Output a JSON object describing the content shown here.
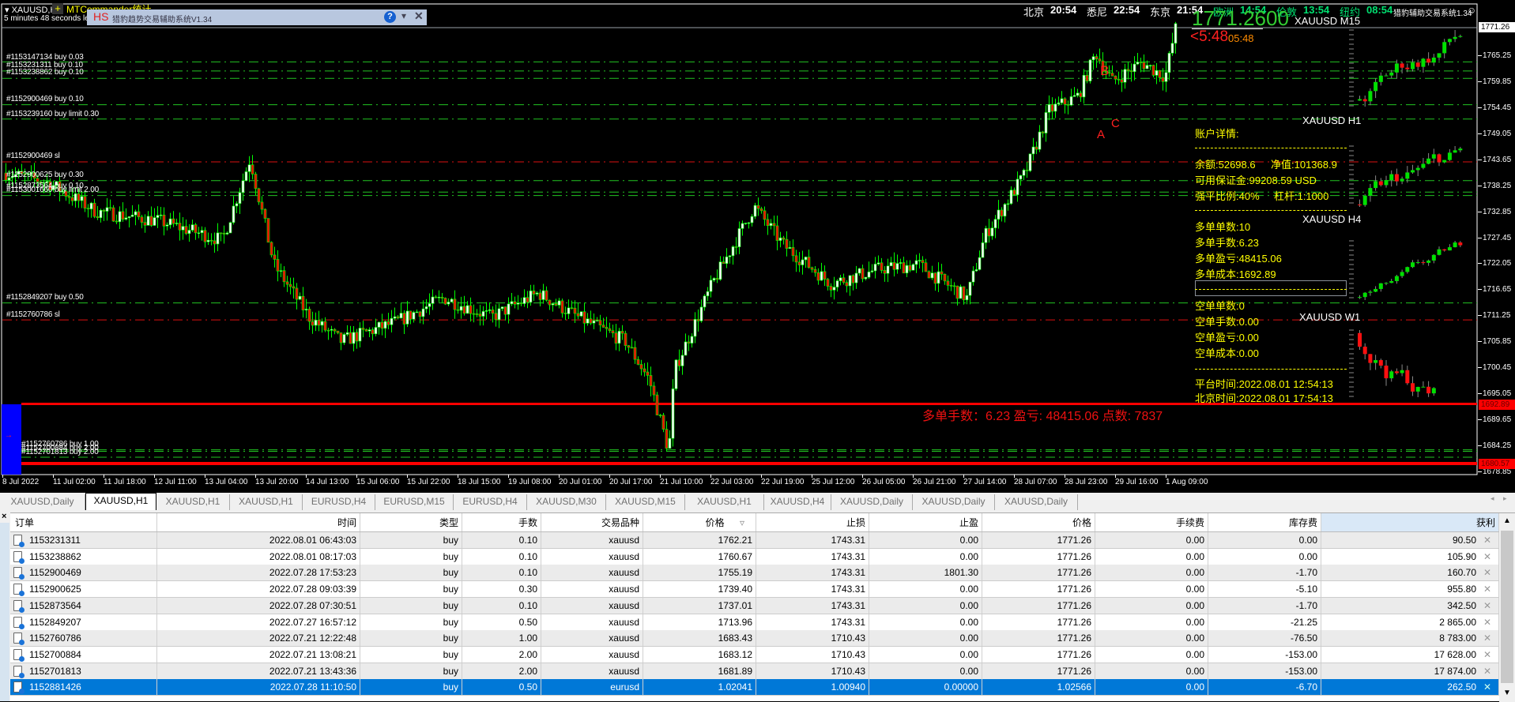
{
  "window": {
    "symbol_title": "XAUUSD,H1",
    "plugin_label": "MTCommander统计",
    "bar_timer": "5 minutes 48 seconds left to bar end"
  },
  "dialog": {
    "logo": "HS",
    "title": "猎豹趋势交易辅助系统V1.34",
    "help_icon": "question-icon",
    "menu_icon": "chevron-down-icon",
    "close_icon": "close-icon"
  },
  "clocks": [
    {
      "city": "北京",
      "time": "20:54",
      "group": "asia"
    },
    {
      "city": "悉尼",
      "time": "22:54",
      "group": "asia"
    },
    {
      "city": "东京",
      "time": "21:54",
      "group": "asia"
    },
    {
      "city": "欧洲",
      "time": "14:54",
      "group": "west"
    },
    {
      "city": "伦敦",
      "time": "13:54",
      "group": "west"
    },
    {
      "city": "纽约",
      "time": "08:54",
      "group": "west"
    }
  ],
  "system_label": "猎豹辅助交易系统1.34",
  "current_price": "1771.2600",
  "countdown": "<5:48",
  "countdown2": "05:48",
  "mini_charts": [
    "XAUUSD M15",
    "XAUUSD H1",
    "XAUUSD H4",
    "XAUUSD W1"
  ],
  "account": {
    "title": "账户详情:",
    "balance": "余额:52698.6",
    "equity": "净值:101368.9",
    "free_margin": "可用保证金:99208.59 USD",
    "stopout": "强平比例:40%",
    "leverage": "杠杆:1:1000",
    "long_count": "多单单数:10",
    "long_lots": "多单手数:6.23",
    "long_pl": "多单盈亏:48415.06",
    "long_cost": "多单成本:1692.89",
    "short_count": "空单单数:0",
    "short_lots": "空单手数:0.00",
    "short_pl": "空单盈亏:0.00",
    "short_cost": "空单成本:0.00",
    "platform_time": "平台时间:2022.08.01 12:54:13",
    "beijing_time": "北京时间:2022.08.01 17:54:13"
  },
  "summary_line": "多单手数：6.23  盈亏: 48415.06  点数: 7837",
  "pattern_labels": [
    "A",
    "B",
    "C"
  ],
  "order_labels": [
    "#1153147134 buy 0.03",
    "#1153231311 buy 0.10",
    "#1153238862 buy 0.10",
    "#1152900469 buy 0.10",
    "#1153239160 buy limit 0.30",
    "#1152900469 sl",
    "#1152900625 buy 0.30",
    "#1152873564 buy 0.10",
    "#1153001660 buy limit 2.00",
    "#1152849207 buy 0.50",
    "#1152760786 sl",
    "#1152760786 buy 1.00",
    "#1152700884 buy 2.00",
    "#1152701813 buy 2.00"
  ],
  "price_axis": [
    "1765.25",
    "1759.85",
    "1754.45",
    "1749.05",
    "1743.65",
    "1738.25",
    "1732.85",
    "1727.45",
    "1722.05",
    "1716.65",
    "1711.25",
    "1705.85",
    "1700.45",
    "1695.05",
    "1689.65",
    "1684.25",
    "1678.85"
  ],
  "price_tags": {
    "bid": "1771.26",
    "cost": "1692.89",
    "low": "1680.57"
  },
  "time_axis": [
    "8 Jul 2022",
    "11 Jul 02:00",
    "11 Jul 18:00",
    "12 Jul 11:00",
    "13 Jul 04:00",
    "13 Jul 20:00",
    "14 Jul 13:00",
    "15 Jul 06:00",
    "15 Jul 22:00",
    "18 Jul 15:00",
    "19 Jul 08:00",
    "20 Jul 01:00",
    "20 Jul 17:00",
    "21 Jul 10:00",
    "22 Jul 03:00",
    "22 Jul 19:00",
    "25 Jul 12:00",
    "26 Jul 05:00",
    "26 Jul 21:00",
    "27 Jul 14:00",
    "28 Jul 07:00",
    "28 Jul 23:00",
    "29 Jul 16:00",
    "1 Aug 09:00"
  ],
  "tabs": [
    {
      "label": "XAUUSD,Daily",
      "active": false
    },
    {
      "label": "XAUUSD,H1",
      "active": true
    },
    {
      "label": "XAUUSD,H1",
      "active": false
    },
    {
      "label": "XAUUSD,H1",
      "active": false
    },
    {
      "label": "EURUSD,H4",
      "active": false
    },
    {
      "label": "EURUSD,M15",
      "active": false
    },
    {
      "label": "EURUSD,H4",
      "active": false
    },
    {
      "label": "XAUUSD,M30",
      "active": false
    },
    {
      "label": "XAUUSD,M15",
      "active": false
    },
    {
      "label": "XAUUSD,H1",
      "active": false
    },
    {
      "label": "XAUUSD,H4",
      "active": false
    },
    {
      "label": "XAUUSD,Daily",
      "active": false
    },
    {
      "label": "XAUUSD,Daily",
      "active": false
    },
    {
      "label": "XAUUSD,Daily",
      "active": false
    }
  ],
  "table": {
    "columns": [
      "订单",
      "时间",
      "类型",
      "手数",
      "交易品种",
      "价格",
      "止损",
      "止盈",
      "价格",
      "手续费",
      "库存费",
      "获利"
    ],
    "sorted_column": "价格",
    "rows": [
      [
        "1153231311",
        "2022.08.01 06:43:03",
        "buy",
        "0.10",
        "xauusd",
        "1762.21",
        "1743.31",
        "0.00",
        "1771.26",
        "0.00",
        "0.00",
        "90.50"
      ],
      [
        "1153238862",
        "2022.08.01 08:17:03",
        "buy",
        "0.10",
        "xauusd",
        "1760.67",
        "1743.31",
        "0.00",
        "1771.26",
        "0.00",
        "0.00",
        "105.90"
      ],
      [
        "1152900469",
        "2022.07.28 17:53:23",
        "buy",
        "0.10",
        "xauusd",
        "1755.19",
        "1743.31",
        "1801.30",
        "1771.26",
        "0.00",
        "-1.70",
        "160.70"
      ],
      [
        "1152900625",
        "2022.07.28 09:03:39",
        "buy",
        "0.30",
        "xauusd",
        "1739.40",
        "1743.31",
        "0.00",
        "1771.26",
        "0.00",
        "-5.10",
        "955.80"
      ],
      [
        "1152873564",
        "2022.07.28 07:30:51",
        "buy",
        "0.10",
        "xauusd",
        "1737.01",
        "1743.31",
        "0.00",
        "1771.26",
        "0.00",
        "-1.70",
        "342.50"
      ],
      [
        "1152849207",
        "2022.07.27 16:57:12",
        "buy",
        "0.50",
        "xauusd",
        "1713.96",
        "1743.31",
        "0.00",
        "1771.26",
        "0.00",
        "-21.25",
        "2 865.00"
      ],
      [
        "1152760786",
        "2022.07.21 12:22:48",
        "buy",
        "1.00",
        "xauusd",
        "1683.43",
        "1710.43",
        "0.00",
        "1771.26",
        "0.00",
        "-76.50",
        "8 783.00"
      ],
      [
        "1152700884",
        "2022.07.21 13:08:21",
        "buy",
        "2.00",
        "xauusd",
        "1683.12",
        "1710.43",
        "0.00",
        "1771.26",
        "0.00",
        "-153.00",
        "17 628.00"
      ],
      [
        "1152701813",
        "2022.07.21 13:43:36",
        "buy",
        "2.00",
        "xauusd",
        "1681.89",
        "1710.43",
        "0.00",
        "1771.26",
        "0.00",
        "-153.00",
        "17 874.00"
      ],
      [
        "1152881426",
        "2022.07.28 11:10:50",
        "buy",
        "0.50",
        "eurusd",
        "1.02041",
        "1.00940",
        "0.00000",
        "1.02566",
        "0.00",
        "-6.70",
        "262.50"
      ]
    ],
    "selected_row": 9
  },
  "colors": {
    "bull": "#00ff00",
    "bear": "#ff0000",
    "account_text": "#ffff00",
    "selection": "#0078d7",
    "clock_west": "#00e070"
  }
}
